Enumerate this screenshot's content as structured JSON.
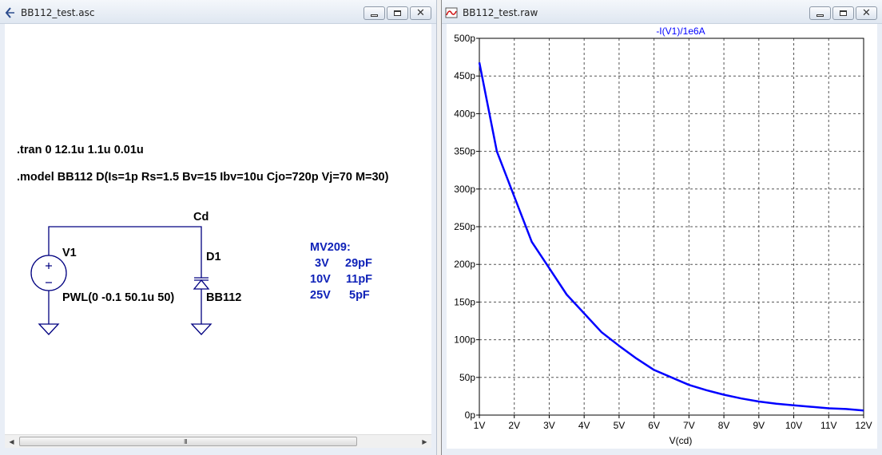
{
  "left_window": {
    "title": "BB112_test.asc",
    "scrollbar_grip": "III",
    "directives": {
      "tran": ".tran 0 12.1u 1.1u 0.01u",
      "model": ".model BB112 D(Is=1p Rs=1.5 Bv=15 Ibv=10u Cjo=720p Vj=70 M=30)"
    },
    "schematic": {
      "net_label": "Cd",
      "source_name": "V1",
      "source_value": "PWL(0 -0.1 50.1u 50)",
      "diode_name": "D1",
      "diode_value": "BB112"
    },
    "comment": {
      "title": "MV209:",
      "rows": [
        {
          "v": "3V",
          "c": "29pF"
        },
        {
          "v": "10V",
          "c": "11pF"
        },
        {
          "v": "25V",
          "c": "5pF"
        }
      ]
    }
  },
  "right_window": {
    "title": "BB112_test.raw"
  },
  "chart_data": {
    "type": "line",
    "title": "-I(V1)/1e6A",
    "xlabel": "V(cd)",
    "ylabel": "",
    "xlim": [
      1,
      12
    ],
    "ylim": [
      0,
      500
    ],
    "x_ticks": [
      "1V",
      "2V",
      "3V",
      "4V",
      "5V",
      "6V",
      "7V",
      "8V",
      "9V",
      "10V",
      "11V",
      "12V"
    ],
    "y_ticks": [
      "0p",
      "50p",
      "100p",
      "150p",
      "200p",
      "250p",
      "300p",
      "350p",
      "400p",
      "450p",
      "500p"
    ],
    "grid": true,
    "series": [
      {
        "color": "#0000ff",
        "x": [
          1,
          1.5,
          2,
          2.5,
          3,
          3.5,
          4,
          4.5,
          5,
          5.5,
          6,
          6.5,
          7,
          7.5,
          8,
          8.5,
          9,
          9.5,
          10,
          10.5,
          11,
          11.5,
          12
        ],
        "y": [
          468,
          350,
          290,
          230,
          195,
          160,
          135,
          110,
          92,
          75,
          60,
          50,
          40,
          33,
          27,
          22,
          18,
          15,
          13,
          11,
          9,
          8,
          6
        ]
      }
    ]
  },
  "colors": {
    "annotation_blue": "#0f22b8",
    "trace_blue": "#0000ff",
    "wire": "#000080"
  }
}
